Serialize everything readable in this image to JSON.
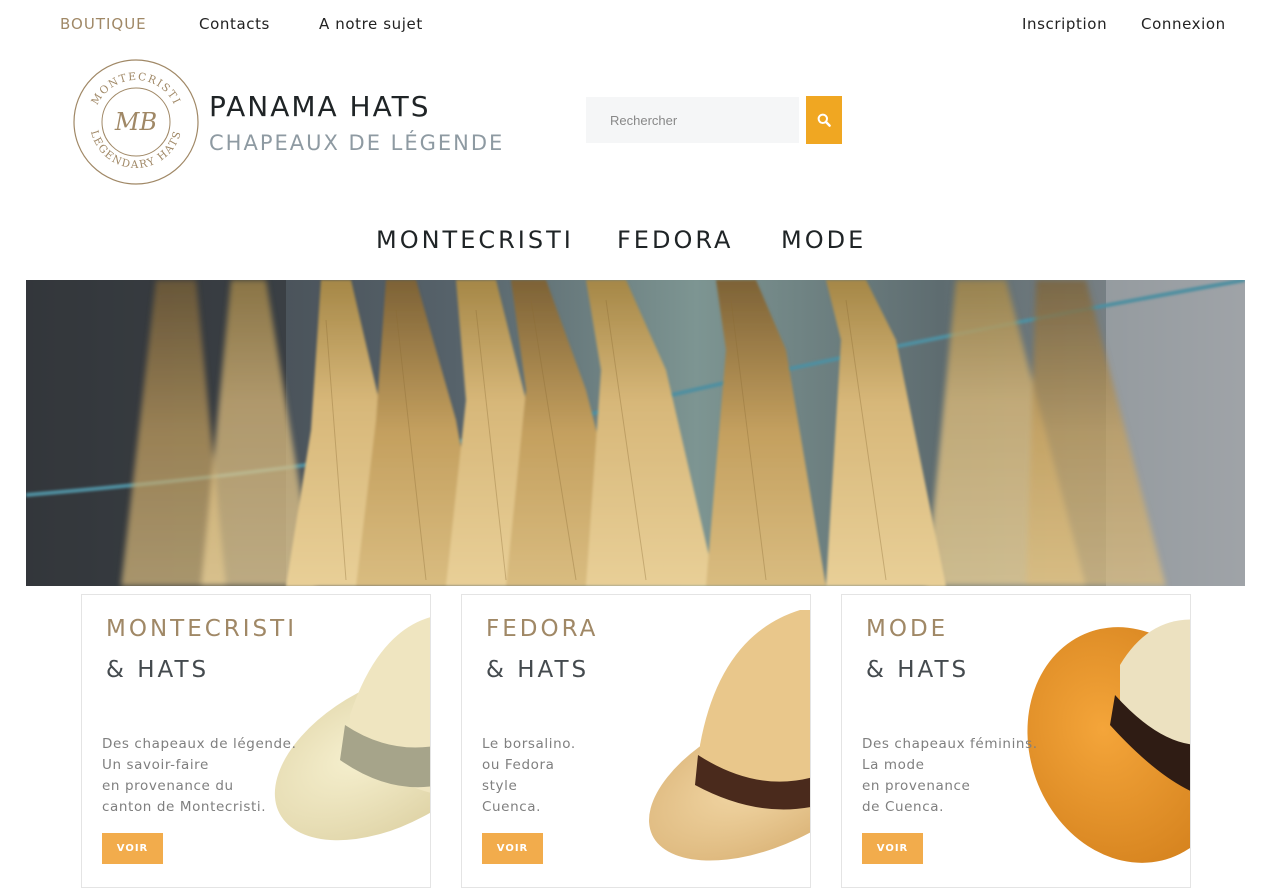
{
  "topnav": {
    "boutique": "BOUTIQUE",
    "contacts": "Contacts",
    "about": "A notre sujet",
    "signup": "Inscription",
    "login": "Connexion"
  },
  "logo": {
    "top_text": "MONTECRISTI",
    "bottom_text": "LEGENDARY HATS",
    "monogram": "MB"
  },
  "brand": {
    "title": "PANAMA HATS",
    "subtitle": "CHAPEAUX DE LÉGENDE"
  },
  "search": {
    "placeholder": "Rechercher",
    "icon": "search-icon"
  },
  "mainnav": [
    "MONTECRISTI",
    "FEDORA",
    "MODE"
  ],
  "colors": {
    "accent_gold": "#a08866",
    "search_button": "#f0a722",
    "voir_button": "#f2ac4c"
  },
  "cards": [
    {
      "title": "MONTECRISTI",
      "subtitle": "& HATS",
      "lines": [
        "Des chapeaux de légende.",
        "Un savoir-faire",
        "en provenance du",
        "canton de Montecristi."
      ],
      "button": "VOIR"
    },
    {
      "title": "FEDORA",
      "subtitle": "& HATS",
      "lines": [
        "Le borsalino.",
        "ou Fedora",
        "style",
        "Cuenca."
      ],
      "button": "VOIR"
    },
    {
      "title": "MODE",
      "subtitle": "& HATS",
      "lines": [
        "Des chapeaux féminins.",
        "La mode",
        "en provenance",
        "de Cuenca."
      ],
      "button": "VOIR"
    }
  ]
}
